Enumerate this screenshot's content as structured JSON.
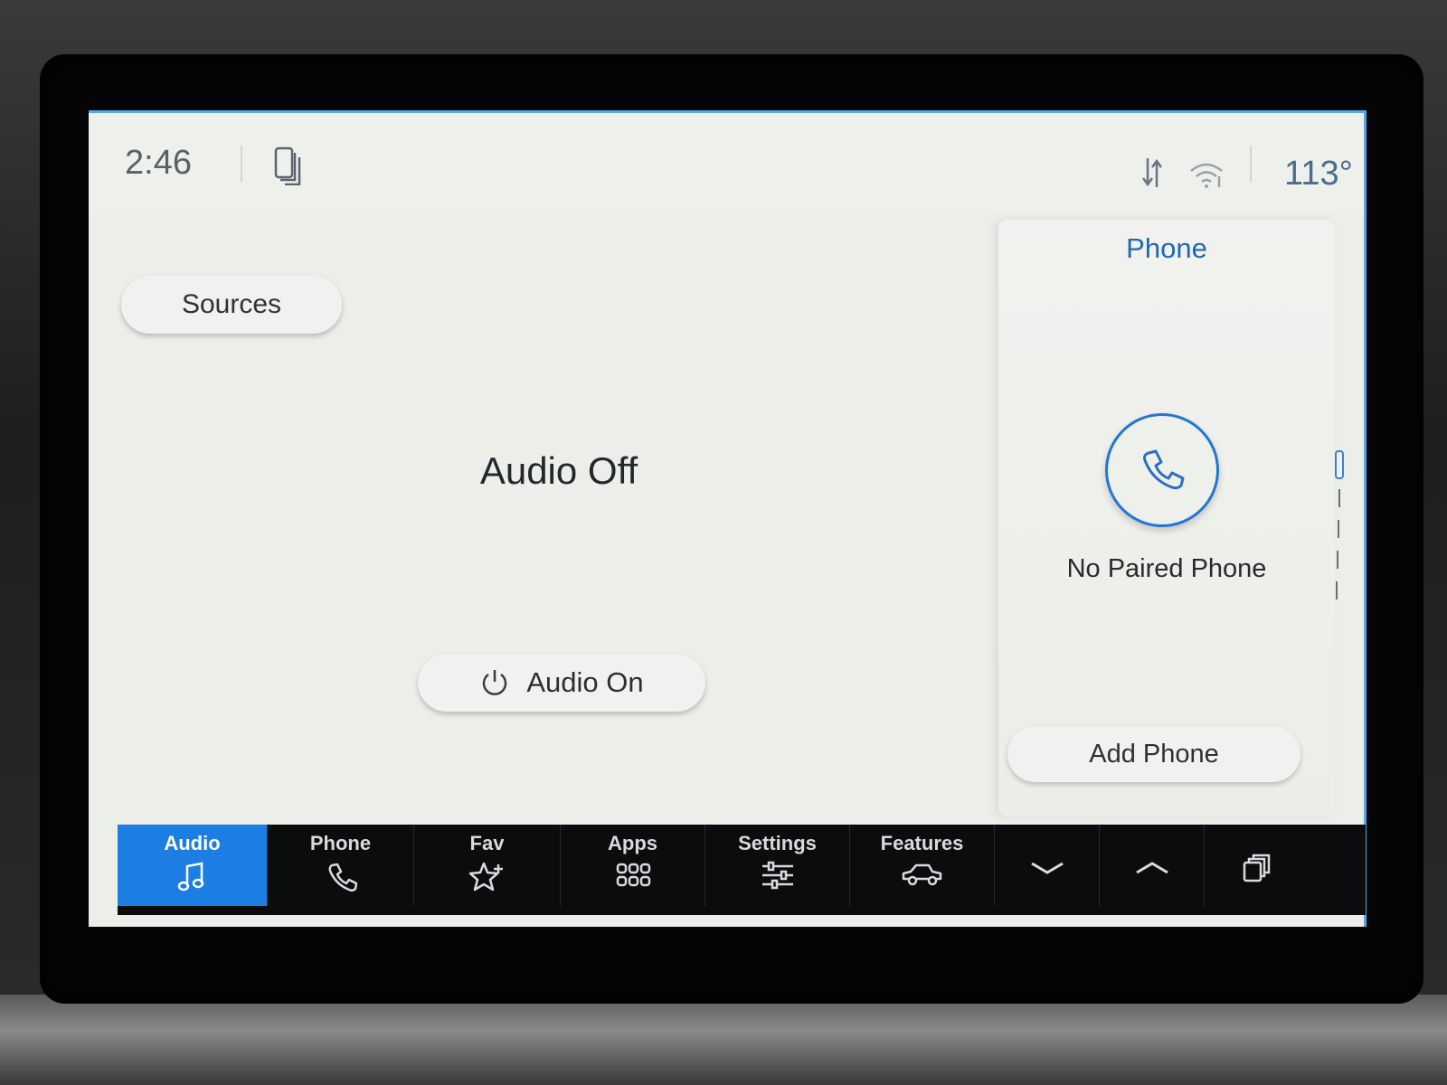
{
  "status": {
    "time": "2:46",
    "temperature": "113°"
  },
  "audio": {
    "sources_label": "Sources",
    "state_text": "Audio Off",
    "audio_on_label": "Audio On"
  },
  "phone_card": {
    "title": "Phone",
    "status_text": "No Paired Phone",
    "add_phone_label": "Add Phone"
  },
  "nav": {
    "audio": "Audio",
    "phone": "Phone",
    "fav": "Fav",
    "apps": "Apps",
    "settings": "Settings",
    "features": "Features",
    "active": "Audio"
  },
  "colors": {
    "accent": "#1c7ee2",
    "card_title": "#1f67b7",
    "screen_background": "#eceeea",
    "nav_background": "#0b0c0e"
  },
  "icons": {
    "status": [
      "phone-projection-icon",
      "data-transfer-icon",
      "wifi-icon"
    ],
    "nav": [
      "music-note-icon",
      "phone-icon",
      "star-plus-icon",
      "app-grid-icon",
      "sliders-icon",
      "car-icon",
      "chevron-down-icon",
      "chevron-up-icon",
      "windows-stack-icon"
    ]
  }
}
